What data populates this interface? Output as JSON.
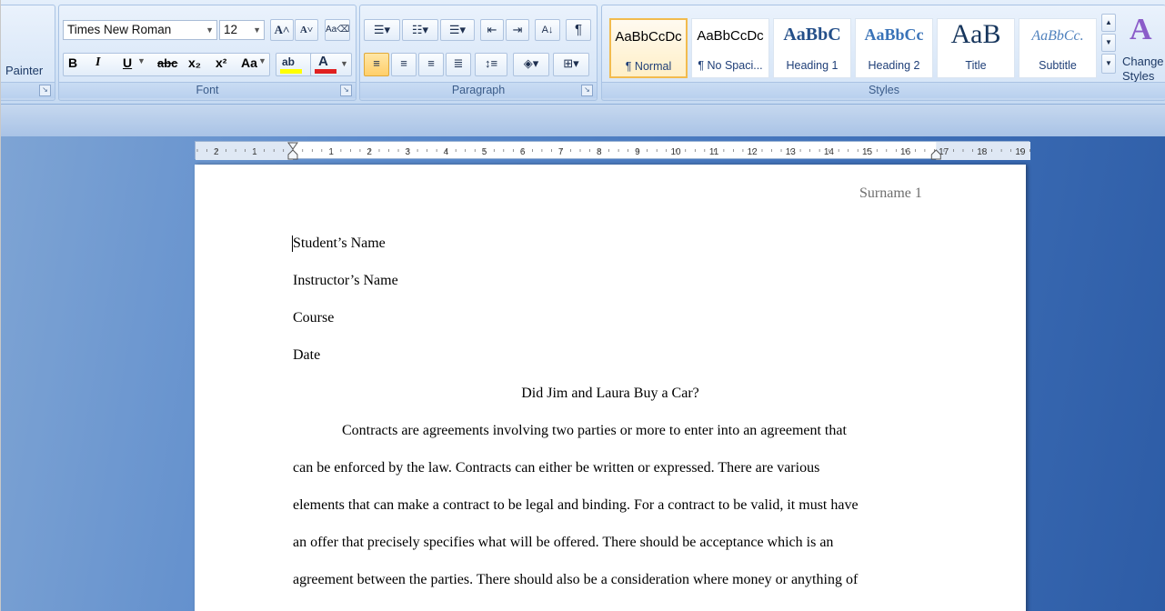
{
  "ribbon": {
    "clipboard": {
      "painter_label": "Painter"
    },
    "font": {
      "label": "Font",
      "font_name": "Times New Roman",
      "font_size": "12",
      "grow_label": "A",
      "shrink_label": "A",
      "bold_label": "B",
      "italic_label": "I",
      "underline_label": "U",
      "strike_label": "abc",
      "subscript_label": "x₂",
      "superscript_label": "x²",
      "case_label": "Aa",
      "highlight_label": "ab",
      "font_color_label": "A",
      "highlight_color": "#ffff00",
      "font_color": "#e02020"
    },
    "paragraph": {
      "label": "Paragraph",
      "show_marks_label": "¶"
    },
    "styles": {
      "label": "Styles",
      "items": [
        {
          "sample": "AaBbCcDc",
          "name": "¶ Normal",
          "selected": true
        },
        {
          "sample": "AaBbCcDc",
          "name": "¶ No Spaci..."
        },
        {
          "sample": "AaBbC",
          "name": "Heading 1"
        },
        {
          "sample": "AaBbCc",
          "name": "Heading 2"
        },
        {
          "sample": "AaB",
          "name": "Title"
        },
        {
          "sample": "AaBbCc.",
          "name": "Subtitle"
        }
      ],
      "change_styles_label_1": "Change",
      "change_styles_label_2": "Styles"
    }
  },
  "ruler": {
    "left_numbers": [
      "2",
      "1"
    ],
    "numbers": [
      "1",
      "2",
      "3",
      "4",
      "5",
      "6",
      "7",
      "8",
      "9",
      "10",
      "11",
      "12",
      "13",
      "14",
      "15",
      "16",
      "17",
      "18",
      "19"
    ]
  },
  "document": {
    "header": "Surname 1",
    "lines": [
      "Student’s Name",
      "Instructor’s Name",
      "Course",
      "Date"
    ],
    "title": "Did Jim and Laura Buy a Car?",
    "body": [
      "Contracts are agreements involving two parties or more to enter into an agreement that",
      "can be enforced by the law. Contracts can either be written or expressed.   There are various",
      "elements that can make a contract to be legal and binding. For a contract to be valid, it must have",
      "an offer that precisely specifies what will be offered. There should be acceptance which is an",
      "agreement between the parties. There should also be a consideration where money or anything of"
    ]
  }
}
